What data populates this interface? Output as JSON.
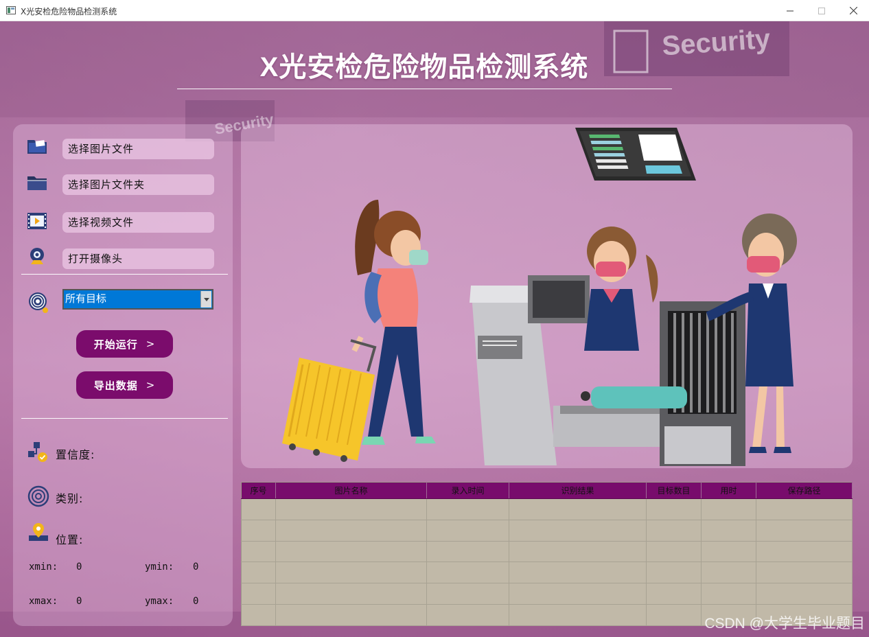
{
  "window": {
    "title": "X光安检危险物品检测系统"
  },
  "header": {
    "title": "X光安检危险物品检测系统"
  },
  "sidebar": {
    "file_buttons": [
      {
        "label": "选择图片文件",
        "icon": "folder-image-icon"
      },
      {
        "label": "选择图片文件夹",
        "icon": "folder-icon"
      },
      {
        "label": "选择视频文件",
        "icon": "video-file-icon"
      },
      {
        "label": "打开摄像头",
        "icon": "webcam-icon"
      }
    ],
    "target_select": {
      "value": "所有目标",
      "icon": "target-icon"
    },
    "start_button": "开始运行",
    "export_button": "导出数据",
    "confidence_label": "置信度:",
    "category_label": "类别:",
    "position_label": "位置:",
    "coords": {
      "xmin_label": "xmin:",
      "xmin_value": "0",
      "ymin_label": "ymin:",
      "ymin_value": "0",
      "xmax_label": "xmax:",
      "xmax_value": "0",
      "ymax_label": "ymax:",
      "ymax_value": "0"
    }
  },
  "table": {
    "headers": [
      "序号",
      "图片名称",
      "录入时间",
      "识别结果",
      "目标数目",
      "用时",
      "保存路径"
    ]
  },
  "background_signs": [
    "Security",
    "Security"
  ],
  "watermark": "CSDN @大学生毕业题目",
  "colors": {
    "accent": "#7b0c6c",
    "table_header": "#780c6c",
    "combo_highlight": "#0078d7",
    "table_body": "#c1b9a8"
  }
}
